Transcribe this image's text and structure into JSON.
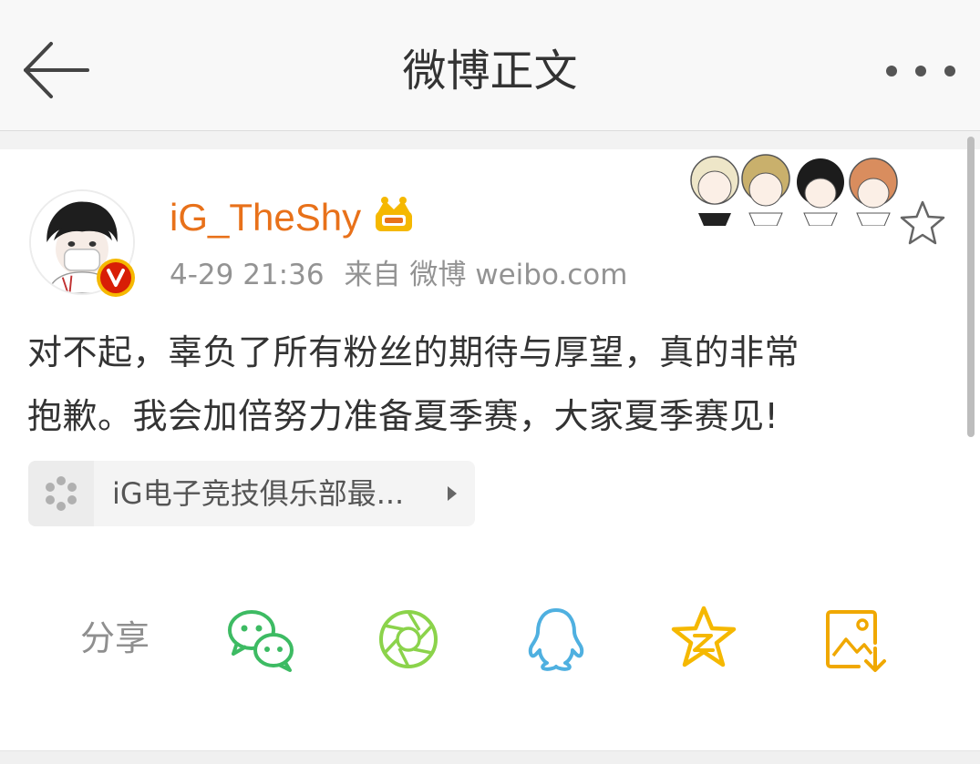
{
  "header": {
    "title": "微博正文",
    "back_icon": "back-arrow-icon",
    "more_icon": "more-dots-icon"
  },
  "post": {
    "username": "iG_TheShy",
    "time": "4-29 21:36",
    "source": "来自 微博 weibo.com",
    "text_line1": "对不起，辜负了所有粉丝的期待与厚望，真的非常",
    "text_line2": "抱歉。我会加倍努力准备夏季赛，大家夏季赛见!",
    "link_title": "iG电子竞技俱乐部最..."
  },
  "share": {
    "label": "分享",
    "icons": [
      "wechat-icon",
      "moments-icon",
      "qq-icon",
      "qzone-icon",
      "save-image-icon"
    ]
  },
  "colors": {
    "username": "#e8711a",
    "wechat": "#3dbb63",
    "moments": "#8bd34b",
    "qq": "#4fb0e0",
    "qzone": "#f5b800",
    "save": "#f0a800",
    "verified": "#d81e06"
  }
}
